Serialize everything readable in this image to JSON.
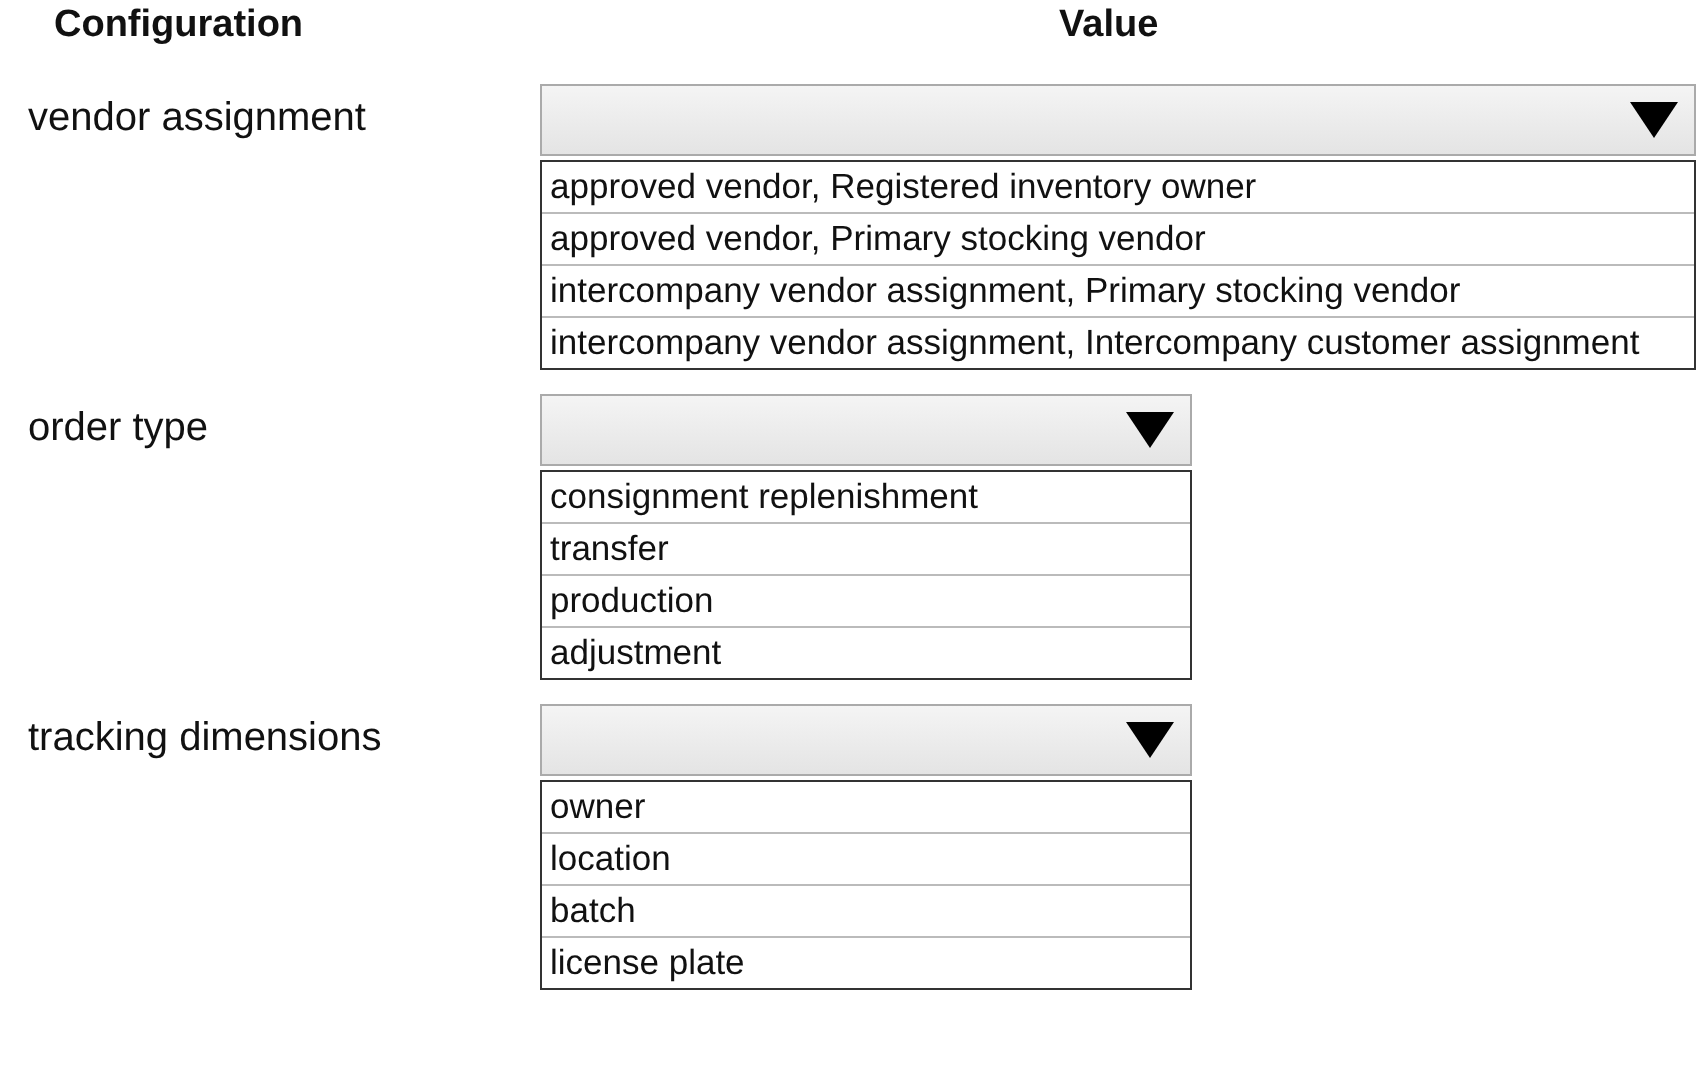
{
  "headers": [
    "Configuration",
    "Value"
  ],
  "rows": [
    {
      "label": "vendor assignment",
      "options": [
        "approved vendor, Registered inventory owner",
        "approved vendor, Primary stocking vendor",
        "intercompany vendor assignment, Primary stocking vendor",
        "intercompany vendor assignment, Intercompany customer assignment"
      ]
    },
    {
      "label": "order type",
      "options": [
        "consignment replenishment",
        "transfer",
        "production",
        "adjustment"
      ]
    },
    {
      "label": "tracking dimensions",
      "options": [
        "owner",
        "location",
        "batch",
        "license plate"
      ]
    }
  ]
}
